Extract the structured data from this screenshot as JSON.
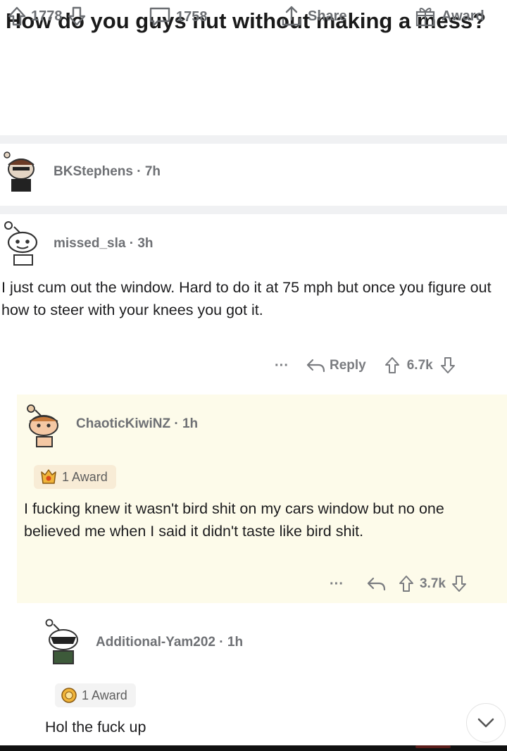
{
  "post": {
    "title": "How do you guys nut without making a mess?",
    "upvotes": "1778",
    "comments": "1758",
    "share_label": "Share",
    "award_label": "Award"
  },
  "comments": [
    {
      "username": "BKStephens",
      "age": "7h",
      "meta": "BKStephens · 7h"
    },
    {
      "username": "missed_sla",
      "age": "3h",
      "meta": "missed_sla · 3h",
      "text": "I just cum out the window. Hard to do it at 75 mph but once you figure out how to steer with your knees you got it.",
      "more": "···",
      "reply_label": "Reply",
      "score": "6.7k"
    },
    {
      "username": "ChaoticKiwiNZ",
      "age": "1h",
      "meta": "ChaoticKiwiNZ · 1h",
      "award": "1 Award",
      "text": "I fucking knew it wasn't bird shit on my cars window but no one believed me when I said it didn't taste like bird shit.",
      "more": "···",
      "score": "3.7k"
    },
    {
      "username": "Additional-Yam202",
      "age": "1h",
      "meta": "Additional-Yam202 · 1h",
      "award": "1 Award",
      "text": "Hol the fuck up"
    }
  ],
  "icons": {
    "upvote": "arrow-up-icon",
    "downvote": "arrow-down-icon",
    "comment": "speech-bubble-icon",
    "share": "share-icon",
    "award": "gift-icon",
    "reply": "reply-arrow-icon",
    "scroll": "chevron-down-icon"
  },
  "colors": {
    "highlight_bg": "#fdfbea",
    "meta_text": "#6e7074",
    "divider": "#f0f1f3"
  }
}
